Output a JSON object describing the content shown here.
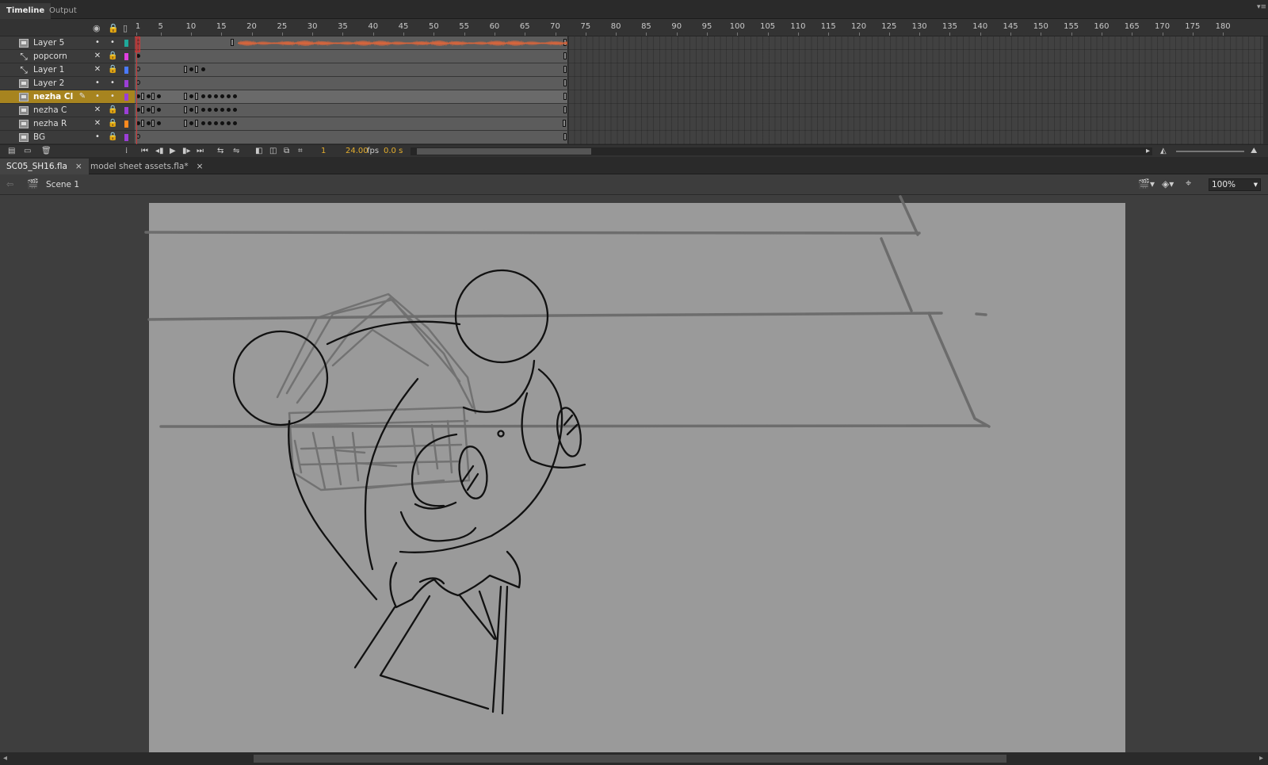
{
  "panel_tabs": {
    "timeline": "Timeline",
    "output": "Output"
  },
  "ruler": {
    "frames": [
      1,
      5,
      10,
      15,
      20,
      25,
      30,
      35,
      40,
      45,
      50,
      55,
      60,
      65,
      70,
      75,
      80,
      85,
      90,
      95,
      100,
      105,
      110,
      115,
      120,
      125,
      130,
      135,
      140,
      145,
      150,
      155,
      160,
      165,
      170,
      175,
      180
    ]
  },
  "layers": [
    {
      "name": "Layer 5",
      "type": "normal",
      "visible": "•",
      "lock": "•",
      "color": "#1fa89a"
    },
    {
      "name": "popcorn",
      "type": "guide",
      "visible": "✕",
      "lock": "🔒",
      "color": "#e040e0"
    },
    {
      "name": "Layer 1",
      "type": "guide",
      "visible": "✕",
      "lock": "🔒",
      "color": "#4a7aff"
    },
    {
      "name": "Layer 2",
      "type": "normal",
      "visible": "•",
      "lock": "•",
      "color": "#9b3fd6"
    },
    {
      "name": "nezha Cl",
      "type": "normal",
      "visible": "•",
      "lock": "•",
      "color": "#9b3fd6",
      "active": true
    },
    {
      "name": "nezha C",
      "type": "normal",
      "visible": "✕",
      "lock": "🔒",
      "color": "#9b3fd6"
    },
    {
      "name": "nezha R",
      "type": "normal",
      "visible": "✕",
      "lock": "🔒",
      "color": "#ff8a1f"
    },
    {
      "name": "BG",
      "type": "normal",
      "visible": "•",
      "lock": "🔒",
      "color": "#9b3fd6"
    }
  ],
  "timeline_toolbar": {
    "current_frame": "1",
    "fps": "24.00",
    "fps_unit": "fps",
    "time": "0.0 s"
  },
  "document_tabs": [
    {
      "label": "SC05_SH16.fla",
      "active": true
    },
    {
      "label": "model sheet assets.fla*",
      "active": false
    }
  ],
  "edit_bar": {
    "scene": "Scene 1",
    "zoom": "100%"
  },
  "colors": {
    "active_layer": "#a7841f",
    "playhead": "#d03a3a",
    "audio_wave": "#e0663a",
    "stage": "#9a9a9a",
    "pasteboard": "#3e3e3e"
  }
}
